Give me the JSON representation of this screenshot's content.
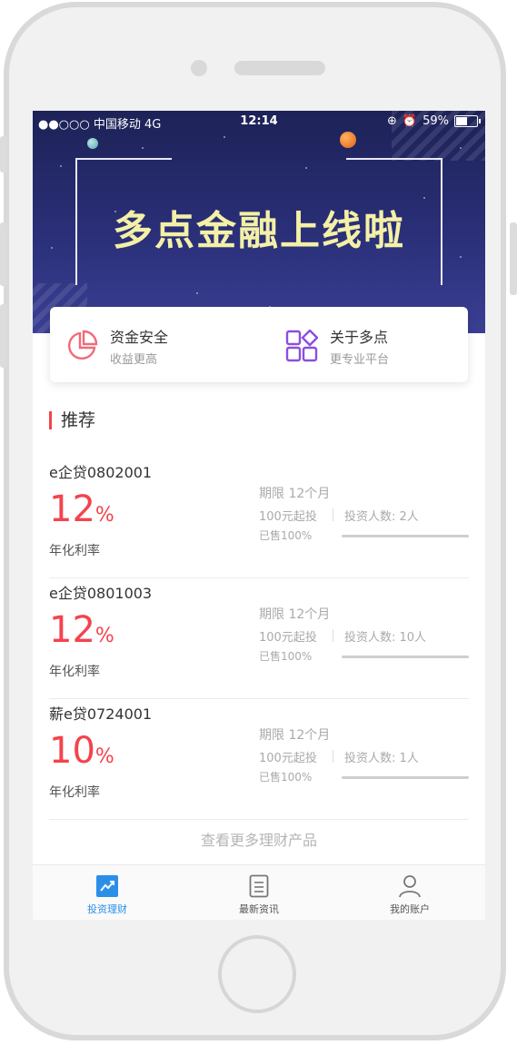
{
  "status_bar": {
    "carrier": "●●○○○ 中国移动  4G",
    "time": "12:14",
    "battery": "59%",
    "battery_level": 0.59
  },
  "banner": {
    "title": "多点金融上线啦"
  },
  "features": [
    {
      "title": "资金安全",
      "subtitle": "收益更高",
      "icon": "pie-chart-icon",
      "color": "#f06b78"
    },
    {
      "title": "关于多点",
      "subtitle": "更专业平台",
      "icon": "grid-apps-icon",
      "color": "#8a4fe0"
    }
  ],
  "section": {
    "title": "推荐"
  },
  "products": [
    {
      "name": "e企贷0802001",
      "rate": "12",
      "rate_unit": "%",
      "rate_label": "年化利率",
      "term": "期限 12个月",
      "min": "100元起投",
      "investors": "投资人数: 2人",
      "sold": "已售100%",
      "progress": 1.0
    },
    {
      "name": "e企贷0801003",
      "rate": "12",
      "rate_unit": "%",
      "rate_label": "年化利率",
      "term": "期限 12个月",
      "min": "100元起投",
      "investors": "投资人数: 10人",
      "sold": "已售100%",
      "progress": 1.0
    },
    {
      "name": "薪e贷0724001",
      "rate": "10",
      "rate_unit": "%",
      "rate_label": "年化利率",
      "term": "期限 12个月",
      "min": "100元起投",
      "investors": "投资人数: 1人",
      "sold": "已售100%",
      "progress": 1.0
    }
  ],
  "more_link": "查看更多理财产品",
  "tabs": [
    {
      "label": "投资理财",
      "icon": "trend-chart-icon",
      "active": true
    },
    {
      "label": "最新资讯",
      "icon": "document-icon",
      "active": false
    },
    {
      "label": "我的账户",
      "icon": "user-icon",
      "active": false
    }
  ],
  "colors": {
    "accent_red": "#f4434c",
    "tab_active": "#2b8fe8",
    "banner_title": "#f4f0a6"
  }
}
